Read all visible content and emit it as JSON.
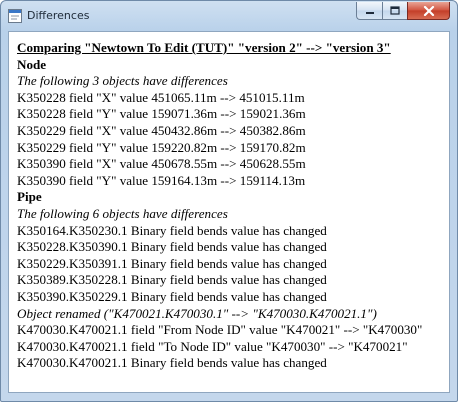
{
  "window": {
    "title": "Differences",
    "icons": {
      "app": "window-app-icon",
      "minimize": "minimize-icon",
      "maximize": "maximize-icon",
      "close": "close-icon"
    }
  },
  "report": {
    "heading": "Comparing \"Newtown To Edit (TUT)\" \"version 2\" --> \"version 3\"",
    "lines": [
      {
        "text": "Node",
        "style": "section"
      },
      {
        "text": "The following 3 objects have differences",
        "style": "note"
      },
      {
        "text": "K350228 field \"X\" value 451065.11m --> 451015.11m",
        "style": "plain"
      },
      {
        "text": "K350228 field \"Y\" value 159071.36m --> 159021.36m",
        "style": "plain"
      },
      {
        "text": "K350229 field \"X\" value 450432.86m --> 450382.86m",
        "style": "plain"
      },
      {
        "text": "K350229 field \"Y\" value 159220.82m --> 159170.82m",
        "style": "plain"
      },
      {
        "text": "K350390 field \"X\" value 450678.55m --> 450628.55m",
        "style": "plain"
      },
      {
        "text": "K350390 field \"Y\" value 159164.13m --> 159114.13m",
        "style": "plain"
      },
      {
        "text": "Pipe",
        "style": "section"
      },
      {
        "text": "The following 6 objects have differences",
        "style": "note"
      },
      {
        "text": "K350164.K350230.1 Binary field bends value has changed",
        "style": "plain"
      },
      {
        "text": "K350228.K350390.1 Binary field bends value has changed",
        "style": "plain"
      },
      {
        "text": "K350229.K350391.1 Binary field bends value has changed",
        "style": "plain"
      },
      {
        "text": "K350389.K350228.1 Binary field bends value has changed",
        "style": "plain"
      },
      {
        "text": "K350390.K350229.1 Binary field bends value has changed",
        "style": "plain"
      },
      {
        "text": "Object renamed (\"K470021.K470030.1\" --> \"K470030.K470021.1\")",
        "style": "note"
      },
      {
        "text": "K470030.K470021.1 field \"From Node ID\" value \"K470021\" --> \"K470030\"",
        "style": "plain"
      },
      {
        "text": "K470030.K470021.1 field \"To Node ID\" value \"K470030\" --> \"K470021\"",
        "style": "plain"
      },
      {
        "text": "K470030.K470021.1 Binary field bends value has changed",
        "style": "plain"
      }
    ]
  }
}
